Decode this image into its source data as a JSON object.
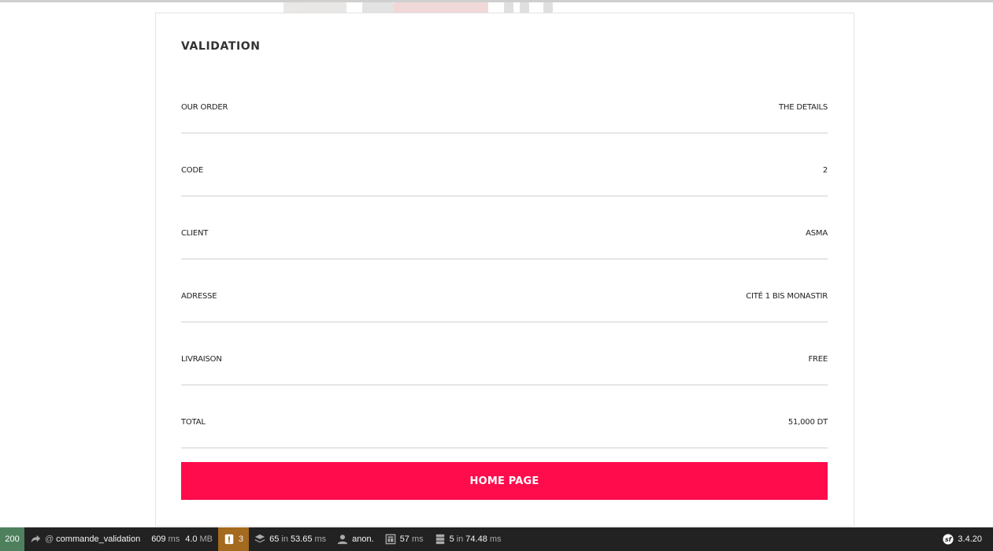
{
  "panel": {
    "title": "VALIDATION",
    "rows": [
      {
        "label": "OUR ORDER",
        "value": "THE DETAILS"
      },
      {
        "label": "CODE",
        "value": "2"
      },
      {
        "label": "CLIENT",
        "value": "ASMA"
      },
      {
        "label": "ADRESSE",
        "value": "CITÉ 1 BIS MONASTIR"
      },
      {
        "label": "LIVRAISON",
        "value": "FREE"
      },
      {
        "label": "TOTAL",
        "value": "51,000 DT"
      }
    ],
    "home_button": "HOME PAGE",
    "accent_color": "#ff0c4d"
  },
  "toolbar": {
    "status_code": "200",
    "route_at": "@",
    "route": "commande_validation",
    "time_value": "609",
    "time_unit": "ms",
    "memory_value": "4.0",
    "memory_unit": "MB",
    "warnings": "3",
    "twig_count": "65",
    "twig_in": "in",
    "twig_time": "53.65",
    "twig_unit": "ms",
    "user": "anon.",
    "render_time": "57",
    "render_unit": "ms",
    "db_count": "5",
    "db_in": "in",
    "db_time": "74.48",
    "db_unit": "ms",
    "version": "3.4.20",
    "icons": [
      "redirect-arrow-icon",
      "warning-icon",
      "layers-icon",
      "user-icon",
      "page-timer-icon",
      "database-icon",
      "symfony-logo-icon"
    ]
  }
}
